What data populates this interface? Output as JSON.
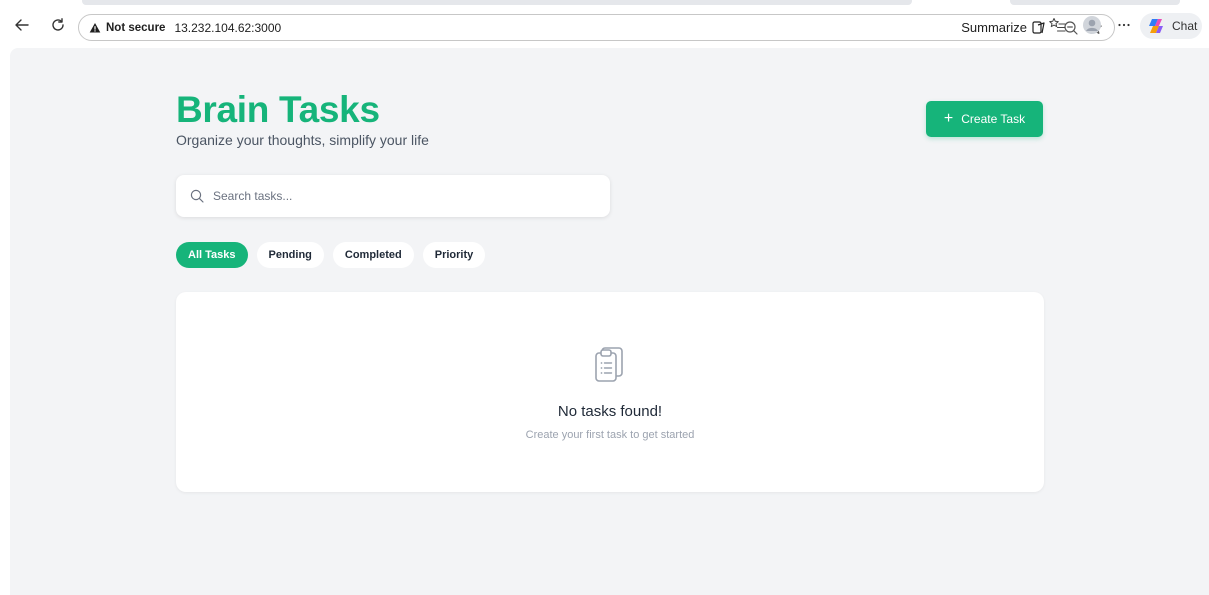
{
  "browser": {
    "security_label": "Not secure",
    "url": "13.232.104.62:3000",
    "summarize_label": "Summarize",
    "chat_label": "Chat",
    "icons": {
      "back": "arrow-left-icon",
      "reload": "reload-icon",
      "security": "warning-triangle-icon",
      "summarize": "summarize-icon",
      "zoom": "zoom-out-icon",
      "favorite": "star-icon",
      "favorites": "favorites-list-icon",
      "profile": "profile-avatar-icon",
      "more": "more-dots-icon",
      "chat": "copilot-icon"
    }
  },
  "header": {
    "title": "Brain Tasks",
    "subtitle": "Organize your thoughts, simplify your life",
    "create_button_label": "Create Task"
  },
  "search": {
    "placeholder": "Search tasks...",
    "value": ""
  },
  "filters": [
    {
      "label": "All Tasks",
      "active": true
    },
    {
      "label": "Pending",
      "active": false
    },
    {
      "label": "Completed",
      "active": false
    },
    {
      "label": "Priority",
      "active": false
    }
  ],
  "empty_state": {
    "icon": "clipboard-icon",
    "title": "No tasks found!",
    "subtitle": "Create your first task to get started"
  },
  "colors": {
    "brand_green": "#16b47a",
    "page_background": "#f3f4f6",
    "card_background": "#ffffff",
    "muted_text": "#9ca3af"
  }
}
